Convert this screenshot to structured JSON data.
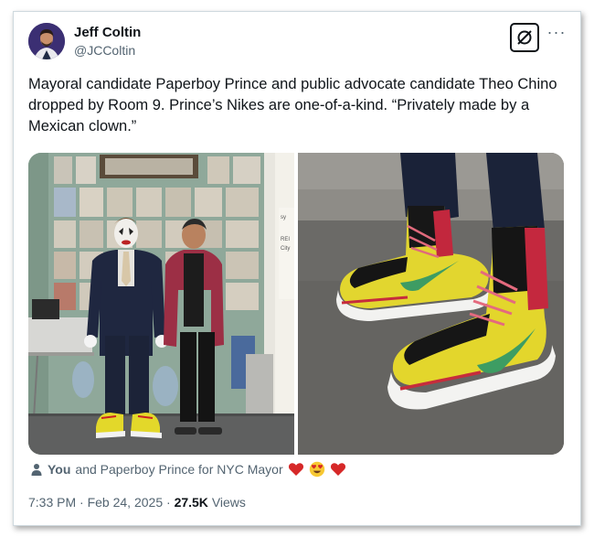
{
  "author": {
    "name": "Jeff Coltin",
    "handle": "@JCColtin"
  },
  "tweet": {
    "text": "Mayoral candidate Paperboy Prince and public advocate candidate Theo Chino dropped by Room 9. Prince’s Nikes are one-of-a-kind. “Privately made by a Mexican clown.”"
  },
  "social_context": {
    "you": "You",
    "rest": "and Paperboy Prince for NYC Mayor",
    "emojis": [
      "heart-icon",
      "heart-eyes-icon",
      "heart-icon"
    ]
  },
  "meta": {
    "time": "7:33 PM",
    "sep1": "·",
    "date": "Feb 24, 2025",
    "sep2": "·",
    "views_count": "27.5K",
    "views_label": "Views"
  },
  "poster_text": {
    "line1": "sy",
    "line2": "REI",
    "line3": "City"
  },
  "icons": {
    "grok": "grok-icon",
    "more": "more-dots-icon",
    "person": "person-icon"
  },
  "colors": {
    "text": "#0f1419",
    "secondary": "#536471",
    "border": "#cfd9de",
    "heart": "#d62828"
  }
}
